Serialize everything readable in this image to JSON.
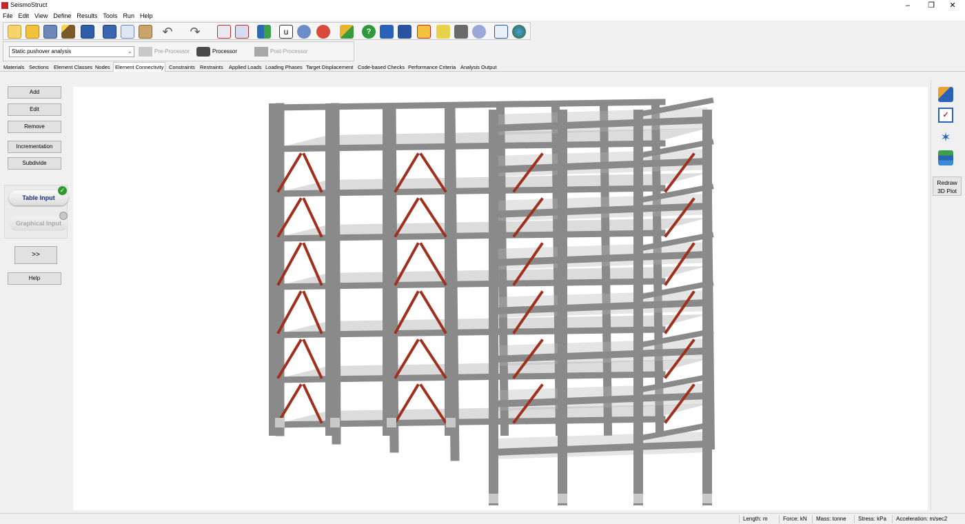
{
  "window": {
    "title": "SeismoStruct"
  },
  "menu": [
    "File",
    "Edit",
    "View",
    "Define",
    "Results",
    "Tools",
    "Run",
    "Help"
  ],
  "toolbar": {
    "icons": [
      "new-file-icon",
      "open-folder-icon",
      "project-explorer-icon",
      "wizard-icon",
      "save-icon",
      "export-icon",
      "copy-icon",
      "paste-icon",
      "undo-icon",
      "redo-icon",
      "building-modeller-icon",
      "pre-processor-icon",
      "mesh-icon",
      "units-icon",
      "settings-gear-icon",
      "advanced-settings-icon",
      "paint-brush-icon",
      "help-icon",
      "manual-icon",
      "tutorial-icon",
      "examples-icon",
      "notes-icon",
      "video-icon",
      "forum-icon",
      "edit-icon",
      "website-globe-icon"
    ]
  },
  "analysis": {
    "type": "Static pushover analysis",
    "pre_processor": "Pre-Processor",
    "processor": "Processor",
    "post_processor": "Post-Processor"
  },
  "tabs": [
    "Materials",
    "Sections",
    "Element Classes",
    "Nodes",
    "Element Connectivity",
    "Constraints",
    "Restraints",
    "Applied Loads",
    "Loading Phases",
    "Target Displacement",
    "Code-based Checks",
    "Performance Criteria",
    "Analysis Output"
  ],
  "active_tab": "Element Connectivity",
  "left_panel": {
    "add": "Add",
    "edit": "Edit",
    "remove": "Remove",
    "incrementation": "Incrementation",
    "subdivide": "Subdivide",
    "table_input": "Table Input",
    "graphical_input": "Graphical Input",
    "more": ">>",
    "help": "Help"
  },
  "right_panel": {
    "icons": [
      "shapes-icon",
      "checklist-icon",
      "axes-icon",
      "layers-icon"
    ],
    "redraw_line1": "Redraw",
    "redraw_line2": "3D Plot"
  },
  "status": {
    "length": "Length: m",
    "force": "Force: kN",
    "mass": "Mass: tonne",
    "stress": "Stress: kPa",
    "acceleration": "Acceleration: m/sec2"
  },
  "colors": {
    "brace": "#a0301e",
    "frame": "#8a8a8a",
    "active_check": "#2e9a2e"
  }
}
